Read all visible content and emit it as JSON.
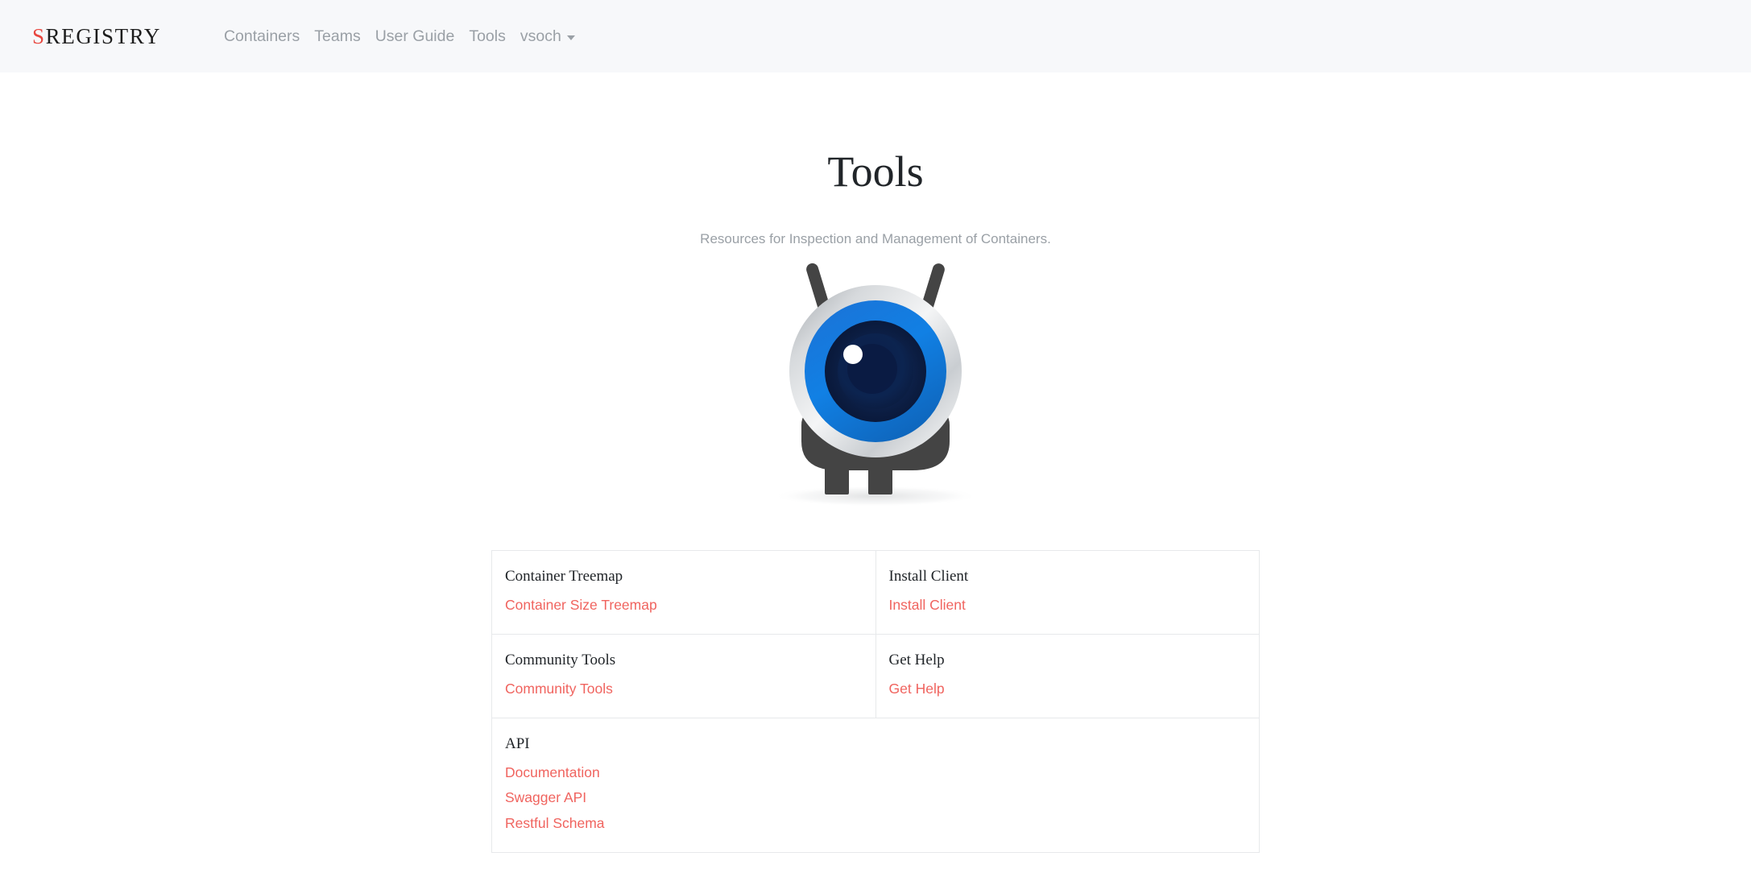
{
  "navbar": {
    "brand_first": "S",
    "brand_rest": "REGISTRY",
    "items": [
      {
        "label": "Containers"
      },
      {
        "label": "Teams"
      },
      {
        "label": "User Guide"
      },
      {
        "label": "Tools"
      }
    ],
    "user_menu": {
      "label": "vsoch",
      "caret_icon": "chevron-down-icon"
    }
  },
  "page": {
    "title": "Tools",
    "subtitle": "Resources for Inspection and Management of Containers.",
    "mascot_icon": "singularity-robot-mascot"
  },
  "tools_table": {
    "rows": [
      {
        "cells": [
          {
            "title": "Container Treemap",
            "links": [
              {
                "label": "Container Size Treemap"
              }
            ]
          },
          {
            "title": "Install Client",
            "links": [
              {
                "label": "Install Client"
              }
            ]
          }
        ]
      },
      {
        "cells": [
          {
            "title": "Community Tools",
            "links": [
              {
                "label": "Community Tools"
              }
            ]
          },
          {
            "title": "Get Help",
            "links": [
              {
                "label": "Get Help"
              }
            ]
          }
        ]
      },
      {
        "cells": [
          {
            "title": "API",
            "colspan": 2,
            "links": [
              {
                "label": "Documentation"
              },
              {
                "label": "Swagger API"
              },
              {
                "label": "Restful Schema"
              }
            ]
          }
        ]
      }
    ]
  },
  "colors": {
    "brand_accent": "#e8473f",
    "link": "#f0645f",
    "navbar_bg": "#f7f8fa",
    "muted_text": "#9aa0a6",
    "body_text": "#212529",
    "border": "#e7e9eb",
    "robot_body": "#444444",
    "robot_eye_blue": "#1578d3",
    "robot_eye_dark": "#0b1a48",
    "robot_ring_silver": "#d9dcdf"
  }
}
